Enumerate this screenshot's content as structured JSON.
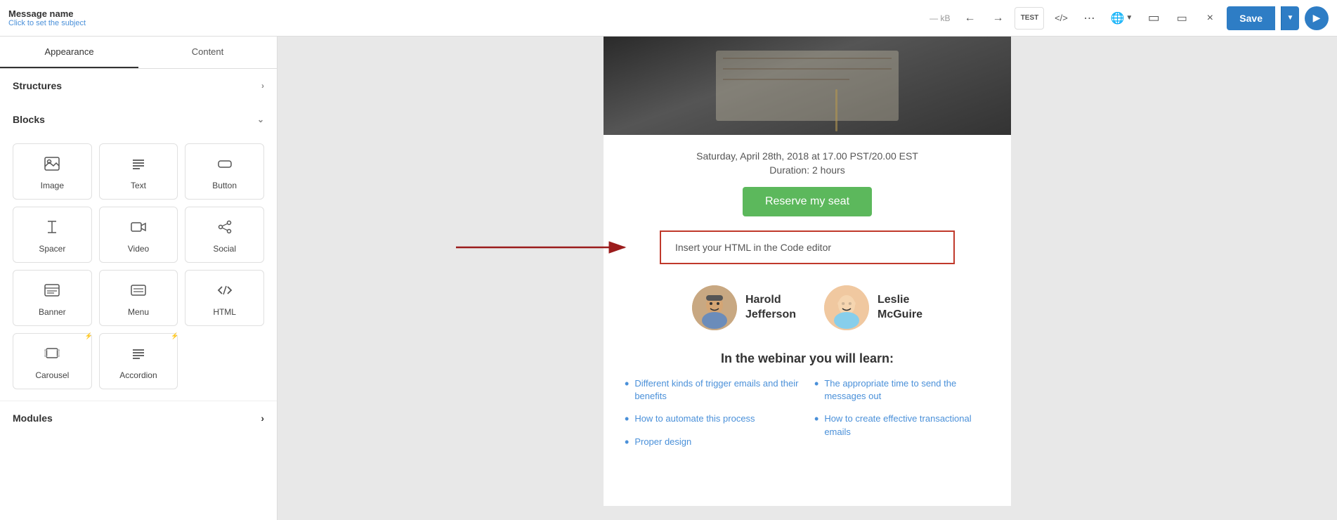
{
  "tabs": {
    "appearance": "Appearance",
    "content": "Content"
  },
  "topbar": {
    "message_name": "Message name",
    "subject_placeholder": "Click to set the subject",
    "kb": "— kB",
    "save_label": "Save",
    "test_label": "TEST"
  },
  "sidebar": {
    "structures_label": "Structures",
    "blocks_label": "Blocks",
    "modules_label": "Modules",
    "blocks": [
      {
        "id": "image",
        "icon": "🖼",
        "label": "Image"
      },
      {
        "id": "text",
        "icon": "≡",
        "label": "Text"
      },
      {
        "id": "button",
        "icon": "⬜",
        "label": "Button"
      },
      {
        "id": "spacer",
        "icon": "✛",
        "label": "Spacer"
      },
      {
        "id": "video",
        "icon": "🎞",
        "label": "Video"
      },
      {
        "id": "social",
        "icon": "↗",
        "label": "Social"
      },
      {
        "id": "banner",
        "icon": "▤",
        "label": "Banner"
      },
      {
        "id": "menu",
        "icon": "⊟",
        "label": "Menu"
      },
      {
        "id": "html",
        "icon": "</>",
        "label": "HTML"
      },
      {
        "id": "carousel",
        "icon": "🖼",
        "label": "Carousel",
        "badge": "⚡"
      },
      {
        "id": "accordion",
        "icon": "≡",
        "label": "Accordion",
        "badge": "⚡"
      }
    ]
  },
  "preview": {
    "event_date": "Saturday, April 28th, 2018 at 17.00 PST/20.00 EST",
    "event_duration": "Duration: 2 hours",
    "reserve_btn": "Reserve my seat",
    "html_placeholder": "Insert your HTML in the Code editor",
    "speakers": [
      {
        "id": "harold",
        "name_line1": "Harold",
        "name_line2": "Jefferson"
      },
      {
        "id": "leslie",
        "name_line1": "Leslie",
        "name_line2": "McGuire"
      }
    ],
    "learn_title": "In the webinar you will learn:",
    "learn_items_left": [
      "Different kinds of trigger emails and their benefits",
      "How to automate this process",
      "Proper design"
    ],
    "learn_items_right": [
      "The appropriate time to send the messages out",
      "How to create effective transactional emails"
    ]
  }
}
